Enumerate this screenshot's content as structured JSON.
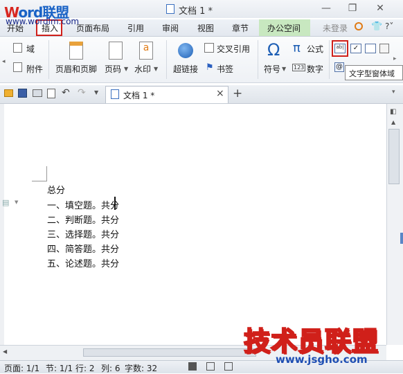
{
  "logo": {
    "brand_w": "W",
    "brand_rest": "ord联盟",
    "url": "www.wordlm.com"
  },
  "window": {
    "title": "文档 1 *"
  },
  "menu": {
    "tabs": [
      "开始",
      "插入",
      "页面布局",
      "引用",
      "审阅",
      "视图",
      "章节",
      "办公空间"
    ],
    "login": "未登录",
    "active_tab": "插入"
  },
  "ribbon": {
    "field": "域",
    "attachment": "附件",
    "header_footer": "页眉和页脚",
    "page_number": "页码",
    "watermark": "水印",
    "hyperlink": "超链接",
    "cross_reference": "交叉引用",
    "bookmark": "书签",
    "symbol": "符号",
    "formula": "公式",
    "number": "数字",
    "tooltip": "文字型窗体域",
    "formula_symbol": "π",
    "number_glyph": "123",
    "symbol_glyph": "Ω"
  },
  "doc_tab": {
    "label": "文档 1 *",
    "close": "×",
    "new": "+"
  },
  "document": {
    "lines": [
      "总分",
      "一、填空题。共分",
      "二、判断题。共分",
      "三、选择题。共分",
      "四、简答题。共分",
      "五、论述题。共分"
    ]
  },
  "status": {
    "page": "页面: 1/1",
    "section": "节: 1/1",
    "row": "行: 2",
    "col": "列: 6",
    "chars": "字数: 32"
  },
  "watermark": {
    "brand": "技术员联盟",
    "url": "www.jsgho.com"
  },
  "colors": {
    "accent_red": "#d0201a",
    "brand_blue": "#1a63c6",
    "office_green": "#c8e8c0"
  }
}
